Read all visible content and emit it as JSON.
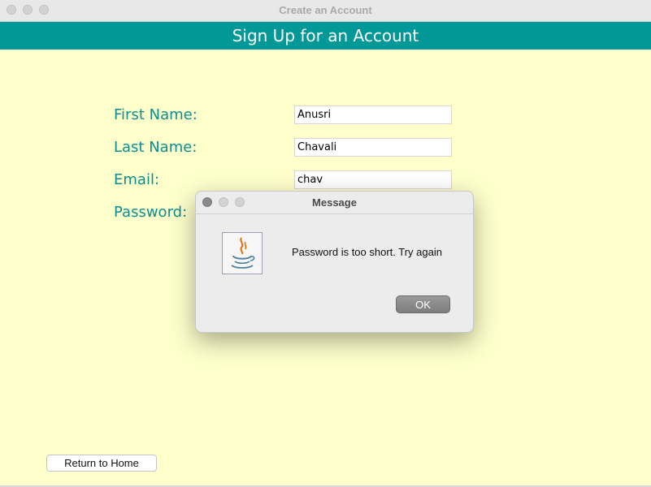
{
  "window": {
    "title": "Create an Account"
  },
  "banner": {
    "title": "Sign Up for an Account"
  },
  "form": {
    "first_name_label": "First Name:",
    "first_name_value": "Anusri",
    "last_name_label": "Last Name:",
    "last_name_value": "Chavali",
    "email_label": "Email:",
    "email_value": "chav",
    "password_label": "Password:"
  },
  "home_button": {
    "label": "Return to Home"
  },
  "dialog": {
    "title": "Message",
    "message": "Password is too short. Try again",
    "ok_label": "OK",
    "icon": "java-icon"
  },
  "colors": {
    "background": "#ffffcc",
    "banner": "#029898",
    "label_text": "#0a8f91"
  }
}
